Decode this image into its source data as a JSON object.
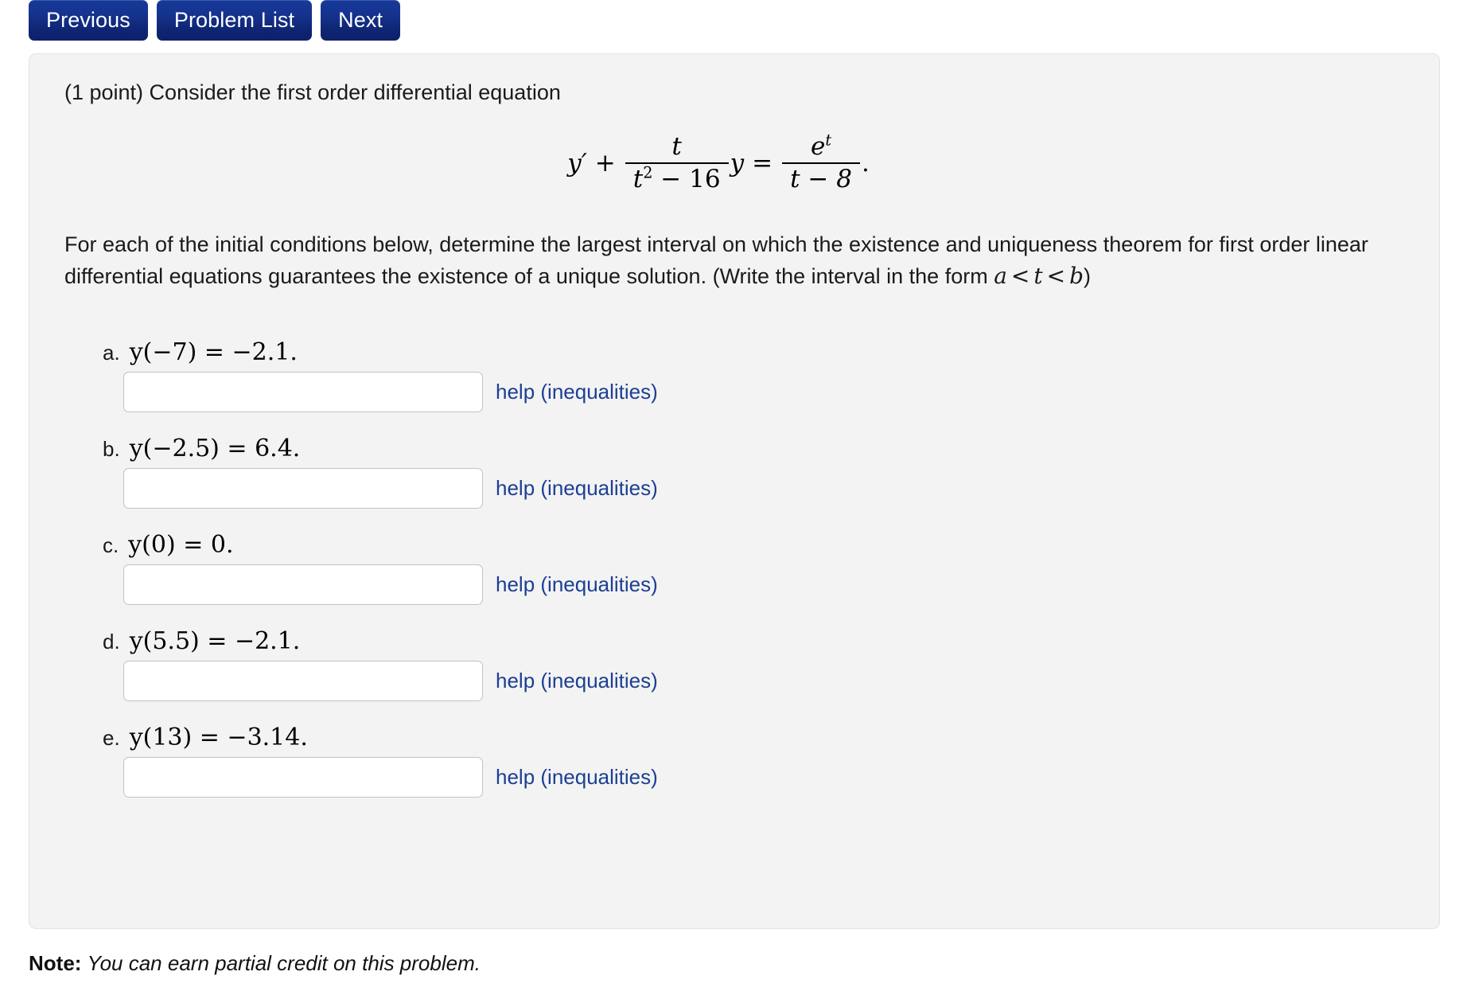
{
  "nav": {
    "buttons": [
      {
        "label": "Previous",
        "name": "previous-button"
      },
      {
        "label": "Problem List",
        "name": "problem-list-button"
      },
      {
        "label": "Next",
        "name": "next-button"
      }
    ]
  },
  "problem": {
    "points_text": "(1 point) Consider the first order differential equation",
    "equation": {
      "lhs_function": "y",
      "prime": "′",
      "plus": "+",
      "coef_numerator": "t",
      "coef_denominator_base": "t",
      "coef_denominator_exponent": "2",
      "coef_denominator_rest": "− 16",
      "times_y": "y",
      "equals": "=",
      "rhs_numerator_base": "e",
      "rhs_numerator_exponent": "t",
      "rhs_denominator": "t − 8",
      "period": "."
    },
    "instructions_part1": "For each of the initial conditions below, determine the largest interval on which the existence and uniqueness theorem for first order linear differential equations guarantees the existence of a unique solution. (Write the interval in the form ",
    "instructions_math_a": "a",
    "instructions_rel1": "<",
    "instructions_math_t": "t",
    "instructions_rel2": "<",
    "instructions_math_b": "b",
    "instructions_part2": ")",
    "answers": [
      {
        "label": "a.",
        "condition": "y(−7) = −2.1.",
        "value": "",
        "placeholder": "",
        "help_label": "help (inequalities)"
      },
      {
        "label": "b.",
        "condition": "y(−2.5) = 6.4.",
        "value": "",
        "placeholder": "",
        "help_label": "help (inequalities)"
      },
      {
        "label": "c.",
        "condition": "y(0) = 0.",
        "value": "",
        "placeholder": "",
        "help_label": "help (inequalities)"
      },
      {
        "label": "d.",
        "condition": "y(5.5) = −2.1.",
        "value": "",
        "placeholder": "",
        "help_label": "help (inequalities)"
      },
      {
        "label": "e.",
        "condition": "y(13) = −3.14.",
        "value": "",
        "placeholder": "",
        "help_label": "help (inequalities)"
      }
    ]
  },
  "footer": {
    "note_bold": "Note:",
    "note_italic": "You can earn partial credit on this problem."
  },
  "colors": {
    "button_blue": "#15338e",
    "link_blue": "#1c3f94",
    "panel_bg": "#f3f3f3",
    "panel_border": "#e2e2e2",
    "input_border": "#c2c2c2"
  }
}
